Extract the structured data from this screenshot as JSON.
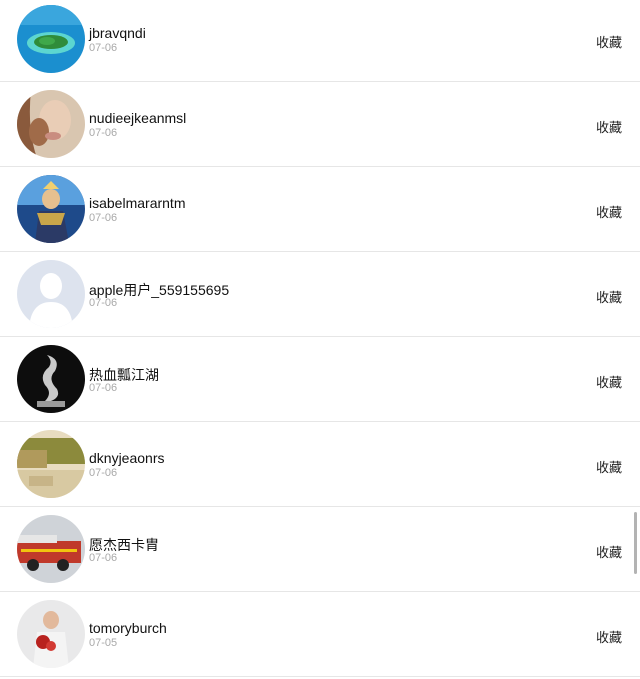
{
  "items": [
    {
      "name": "jbravqndi",
      "date": "07-06",
      "action": "收藏",
      "avatar_icon": "island-photo-avatar-icon"
    },
    {
      "name": "nudieejkeanmsl",
      "date": "07-06",
      "action": "收藏",
      "avatar_icon": "woman-portrait-avatar-icon"
    },
    {
      "name": "isabelmararntm",
      "date": "07-06",
      "action": "收藏",
      "avatar_icon": "game-character-avatar-icon"
    },
    {
      "name": "apple用户_559155695",
      "date": "07-06",
      "action": "收藏",
      "avatar_icon": "default-user-avatar-icon"
    },
    {
      "name": "热血瓢江湖",
      "date": "07-06",
      "action": "收藏",
      "avatar_icon": "dragon-sculpture-avatar-icon"
    },
    {
      "name": "dknyjeaonrs",
      "date": "07-06",
      "action": "收藏",
      "avatar_icon": "room-interior-avatar-icon"
    },
    {
      "name": "愿杰西卡胄",
      "date": "07-06",
      "action": "收藏",
      "avatar_icon": "fire-truck-avatar-icon"
    },
    {
      "name": "tomoryburch",
      "date": "07-05",
      "action": "收藏",
      "avatar_icon": "person-with-flowers-avatar-icon"
    }
  ],
  "colors": {
    "name": "#111111",
    "date": "#a9a9a9",
    "divider": "#e6e6e6",
    "action": "#222222"
  }
}
